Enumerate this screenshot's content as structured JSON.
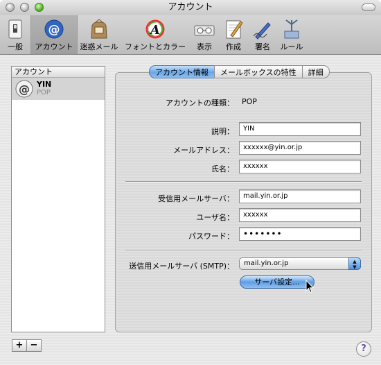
{
  "window": {
    "title": "アカウント"
  },
  "toolbar": {
    "items": [
      {
        "label": "一般",
        "icon": "general-switch-icon"
      },
      {
        "label": "アカウント",
        "icon": "at-sign-icon"
      },
      {
        "label": "迷惑メール",
        "icon": "junk-mail-bag-icon"
      },
      {
        "label": "フォントとカラー",
        "icon": "font-color-icon"
      },
      {
        "label": "表示",
        "icon": "viewing-glasses-icon"
      },
      {
        "label": "作成",
        "icon": "compose-icon"
      },
      {
        "label": "署名",
        "icon": "signature-pen-icon"
      },
      {
        "label": "ルール",
        "icon": "rules-icon"
      }
    ],
    "selected": "アカウント"
  },
  "sidebar": {
    "header": "アカウント",
    "accounts": [
      {
        "name": "YIN",
        "type": "POP"
      }
    ],
    "add_label": "+",
    "remove_label": "−"
  },
  "tabs": [
    {
      "label": "アカウント情報",
      "selected": true
    },
    {
      "label": "メールボックスの特性",
      "selected": false
    },
    {
      "label": "詳細",
      "selected": false
    }
  ],
  "form": {
    "account_type": {
      "label": "アカウントの種類：",
      "value": "POP"
    },
    "description": {
      "label": "説明：",
      "value": "YIN"
    },
    "email": {
      "label": "メールアドレス：",
      "value": "xxxxxx@yin.or.jp"
    },
    "full_name": {
      "label": "氏名：",
      "value": "xxxxxx"
    },
    "incoming_server": {
      "label": "受信用メールサーバ：",
      "value": "mail.yin.or.jp"
    },
    "username": {
      "label": "ユーザ名：",
      "value": "xxxxxx"
    },
    "password": {
      "label": "パスワード：",
      "value": "•••••••"
    },
    "smtp": {
      "label": "送信用メールサーバ (SMTP)：",
      "value": "mail.yin.or.jp"
    },
    "server_settings_button": "サーバ設定..."
  },
  "help_label": "?",
  "colors": {
    "accent": "#5e9de4",
    "selection": "#d4d4d4"
  }
}
